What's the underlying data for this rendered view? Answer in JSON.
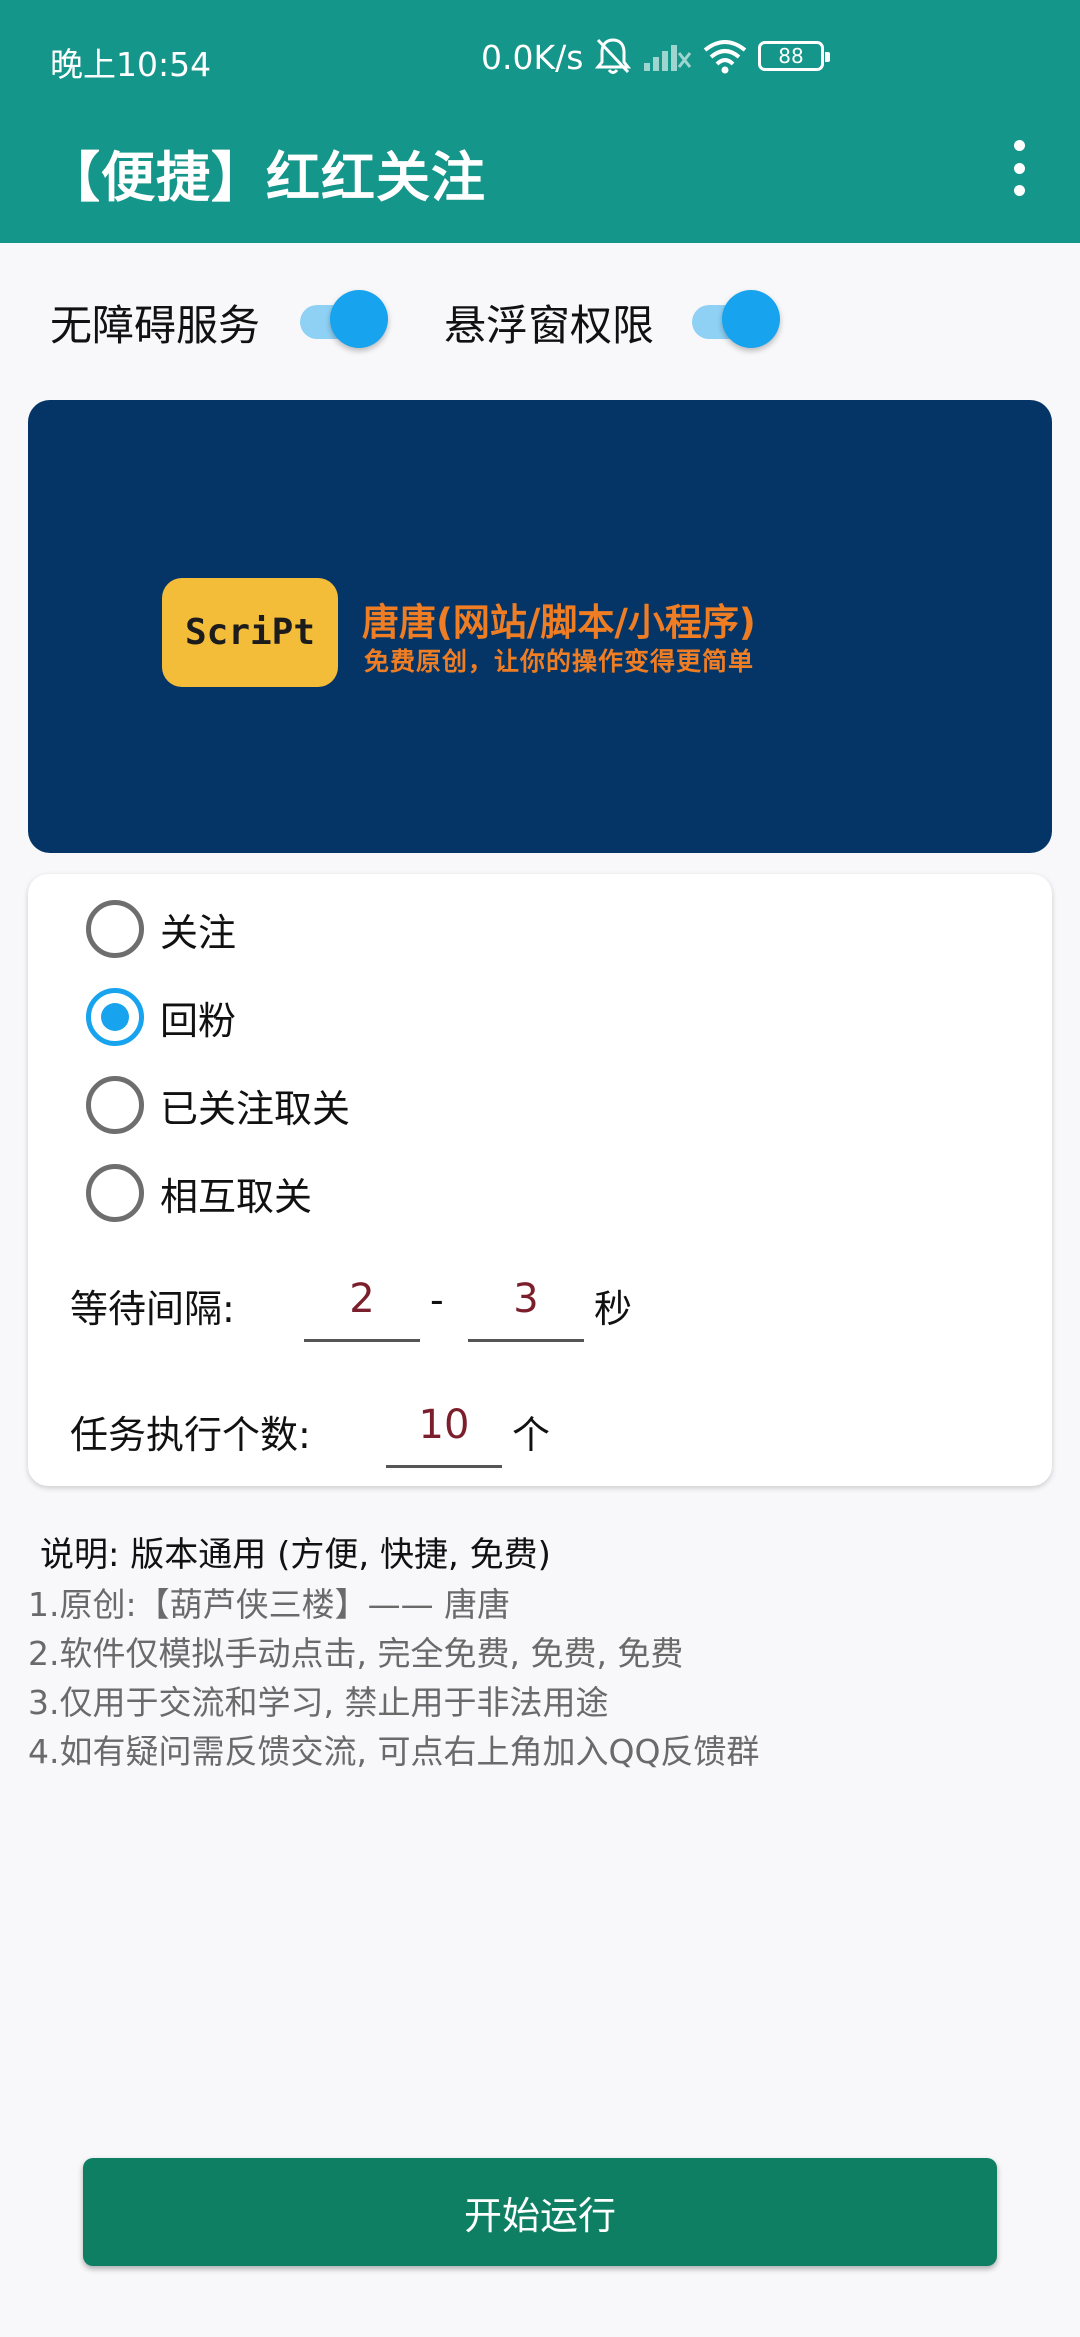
{
  "status_bar": {
    "time": "晚上10:54",
    "net_speed": "0.0K/s",
    "battery": "88"
  },
  "app_bar": {
    "title": "【便捷】红红关注",
    "menu_icon": "more-vert-icon"
  },
  "permissions": {
    "accessibility_label": "无障碍服务",
    "accessibility_on": true,
    "overlay_label": "悬浮窗权限",
    "overlay_on": true
  },
  "banner": {
    "logo_text": "ScriPt",
    "title": "唐唐(网站/脚本/小程序)",
    "subtitle": "免费原创，让你的操作变得更简单"
  },
  "modes": [
    {
      "label": "关注",
      "checked": false
    },
    {
      "label": "回粉",
      "checked": true
    },
    {
      "label": "已关注取关",
      "checked": false
    },
    {
      "label": "相互取关",
      "checked": false
    }
  ],
  "interval": {
    "label": "等待间隔:",
    "min": "2",
    "separator": "-",
    "max": "3",
    "unit": "秒"
  },
  "task_count": {
    "label": "任务执行个数:",
    "value": "10",
    "unit": "个"
  },
  "notes": {
    "heading": "说明: 版本通用 (方便, 快捷, 免费)",
    "lines": [
      "1.原创:【葫芦侠三楼】—— 唐唐",
      "2.软件仅模拟手动点击, 完全免费, 免费, 免费",
      "3.仅用于交流和学习, 禁止用于非法用途",
      "4.如有疑问需反馈交流, 可点右上角加入QQ反馈群"
    ]
  },
  "start_button": "开始运行",
  "colors": {
    "app_bar": "#15968a",
    "accent": "#18a3ee",
    "banner_bg": "#053566",
    "banner_text": "#ef7d23",
    "button": "#0f7f63"
  }
}
